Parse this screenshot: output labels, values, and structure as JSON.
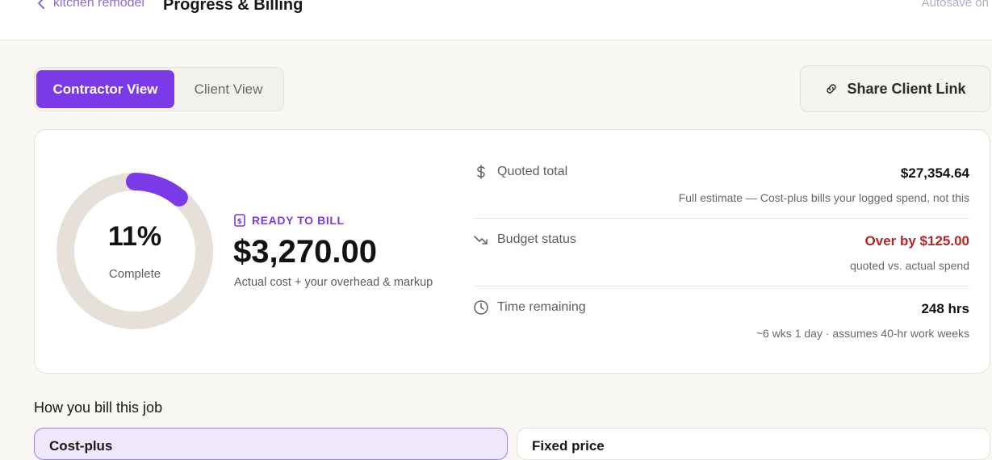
{
  "header": {
    "back_label": "kitchen remodel",
    "title": "Progress & Billing",
    "autosave": "Autosave on"
  },
  "view_toggle": {
    "contractor_label": "Contractor View",
    "client_label": "Client View",
    "active": "contractor"
  },
  "share_button": {
    "label": "Share Client Link",
    "icon": "link-icon"
  },
  "progress": {
    "percent_label": "11%",
    "percent_value": 11,
    "complete_label": "Complete"
  },
  "ready_to_bill": {
    "label": "READY TO BILL",
    "amount": "$3,270.00",
    "subtext": "Actual cost + your overhead & markup",
    "icon": "invoice-icon"
  },
  "metrics": [
    {
      "icon": "dollar-icon",
      "label": "Quoted total",
      "value": "$27,354.64",
      "subtext": "Full estimate — Cost-plus bills your logged spend, not this"
    },
    {
      "icon": "trend-down-icon",
      "label": "Budget status",
      "value": "Over by $125.00",
      "subtext": "quoted vs. actual spend"
    },
    {
      "icon": "clock-icon",
      "label": "Time remaining",
      "value": "248 hrs",
      "subtext": "~6 wks 1 day · assumes 40-hr work weeks"
    }
  ],
  "billing": {
    "heading": "How you bill this job",
    "options": [
      {
        "title": "Cost-plus",
        "selected": true
      },
      {
        "title": "Fixed price",
        "selected": false
      }
    ]
  },
  "colors": {
    "accent": "#7a3ae8",
    "over_budget": "#b32626",
    "ring_track": "#e6e0d8"
  }
}
